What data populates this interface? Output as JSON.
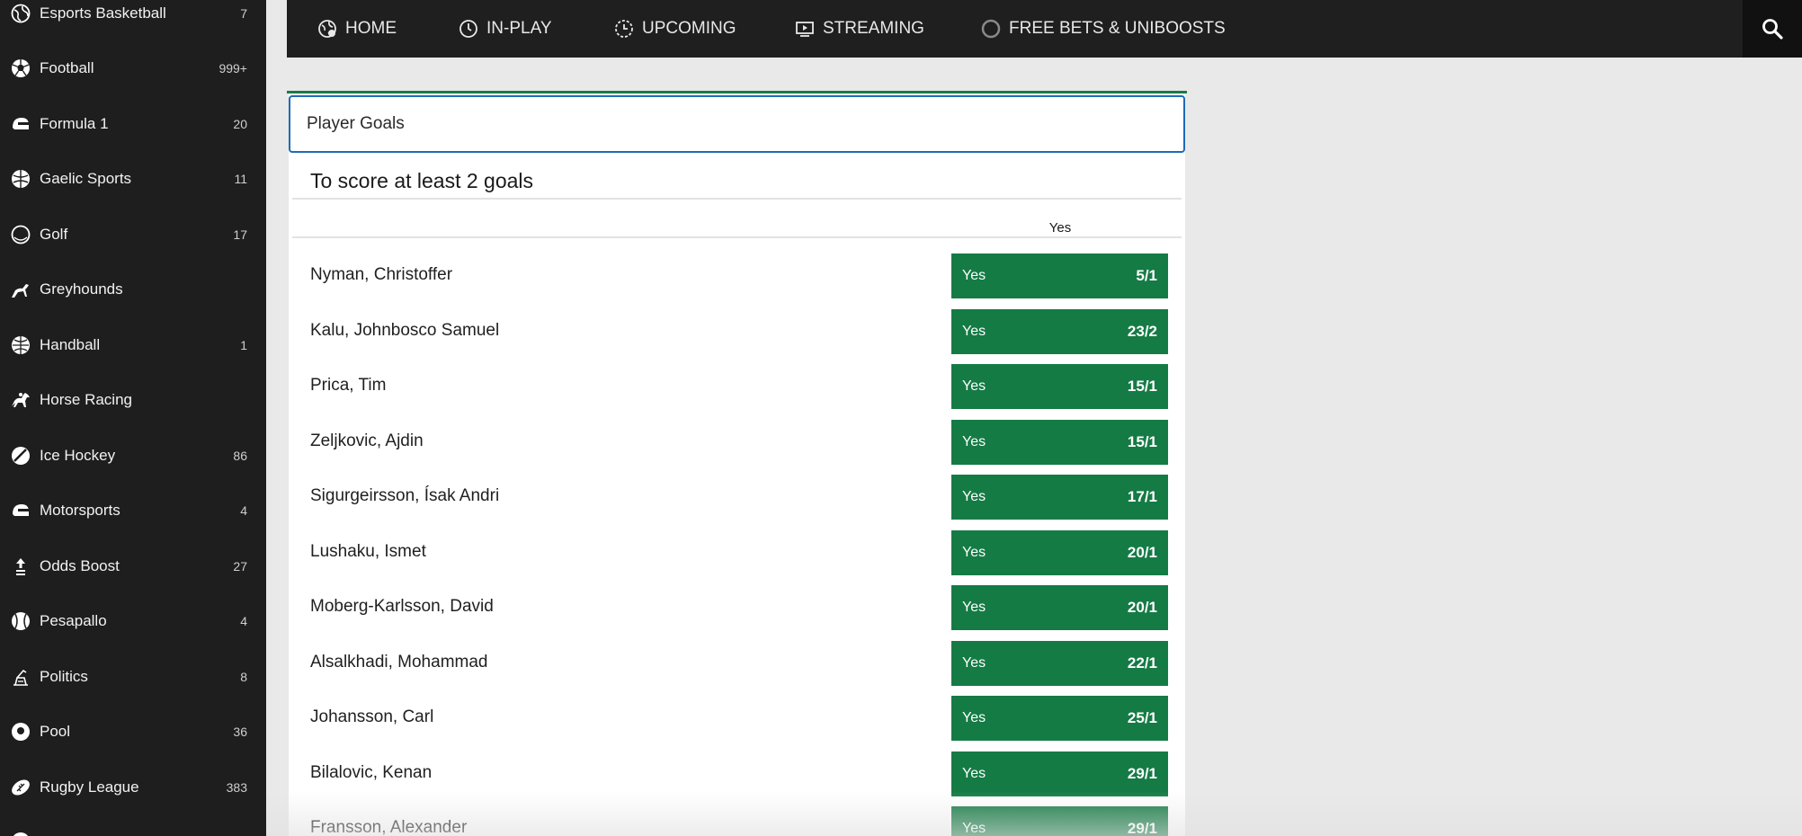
{
  "sidebar": {
    "items": [
      {
        "label": "Esports Basketball",
        "count": "7",
        "icon": "globe-icon"
      },
      {
        "label": "Football",
        "count": "999+",
        "icon": "football-icon"
      },
      {
        "label": "Formula 1",
        "count": "20",
        "icon": "helmet-icon"
      },
      {
        "label": "Gaelic Sports",
        "count": "11",
        "icon": "ball-icon"
      },
      {
        "label": "Golf",
        "count": "17",
        "icon": "golf-ball-icon"
      },
      {
        "label": "Greyhounds",
        "count": "",
        "icon": "greyhound-icon"
      },
      {
        "label": "Handball",
        "count": "1",
        "icon": "handball-icon"
      },
      {
        "label": "Horse Racing",
        "count": "",
        "icon": "horse-icon"
      },
      {
        "label": "Ice Hockey",
        "count": "86",
        "icon": "puck-icon"
      },
      {
        "label": "Motorsports",
        "count": "4",
        "icon": "helmet-icon"
      },
      {
        "label": "Odds Boost",
        "count": "27",
        "icon": "boost-icon"
      },
      {
        "label": "Pesapallo",
        "count": "4",
        "icon": "baseball-icon"
      },
      {
        "label": "Politics",
        "count": "8",
        "icon": "podium-icon"
      },
      {
        "label": "Pool",
        "count": "36",
        "icon": "pool-ball-icon"
      },
      {
        "label": "Rugby League",
        "count": "383",
        "icon": "rugby-ball-icon"
      }
    ]
  },
  "topnav": {
    "items": [
      {
        "label": "HOME",
        "icon": "home-globe-icon"
      },
      {
        "label": "IN-PLAY",
        "icon": "clock-icon"
      },
      {
        "label": "UPCOMING",
        "icon": "upcoming-clock-icon"
      },
      {
        "label": "STREAMING",
        "icon": "streaming-tv-icon"
      },
      {
        "label": "FREE BETS & UNIBOOSTS",
        "icon": "free-bets-ring-icon"
      }
    ],
    "search_icon": "search-icon"
  },
  "market": {
    "header": "Player Goals",
    "title": "To score at least 2 goals",
    "column_header": "Yes",
    "rows": [
      {
        "player": "Nyman, Christoffer",
        "selection": "Yes",
        "odds": "5/1"
      },
      {
        "player": "Kalu, Johnbosco Samuel",
        "selection": "Yes",
        "odds": "23/2"
      },
      {
        "player": "Prica, Tim",
        "selection": "Yes",
        "odds": "15/1"
      },
      {
        "player": "Zeljkovic, Ajdin",
        "selection": "Yes",
        "odds": "15/1"
      },
      {
        "player": "Sigurgeirsson, Ísak Andri",
        "selection": "Yes",
        "odds": "17/1"
      },
      {
        "player": "Lushaku, Ismet",
        "selection": "Yes",
        "odds": "20/1"
      },
      {
        "player": "Moberg-Karlsson, David",
        "selection": "Yes",
        "odds": "20/1"
      },
      {
        "player": "Alsalkhadi, Mohammad",
        "selection": "Yes",
        "odds": "22/1"
      },
      {
        "player": "Johansson, Carl",
        "selection": "Yes",
        "odds": "25/1"
      },
      {
        "player": "Bilalovic, Kenan",
        "selection": "Yes",
        "odds": "29/1"
      },
      {
        "player": "Fransson, Alexander",
        "selection": "Yes",
        "odds": "29/1"
      }
    ]
  },
  "colors": {
    "odds_green": "#157b45",
    "accent_blue": "#1d6bb8",
    "sidebar_bg": "#1e1e1e"
  }
}
